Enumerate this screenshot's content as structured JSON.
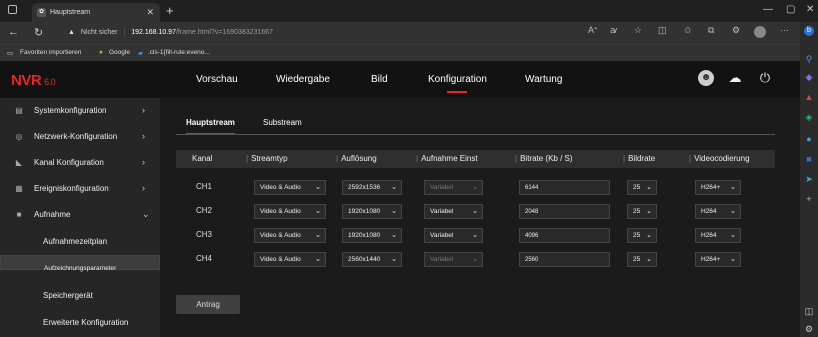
{
  "browser": {
    "tab_title": "Hauptstream",
    "url_security": "Nicht sicher",
    "url_host": "192.168.10.97",
    "url_path": "/frame.html?v=1690383231667",
    "bookmarks": [
      "Favoriten importieren",
      "Google",
      ".cls-1{fill-rule:eveno..."
    ]
  },
  "app": {
    "logo": "NVR",
    "version": "6.0",
    "nav": [
      "Vorschau",
      "Wiedergabe",
      "Bild",
      "Konfiguration",
      "Wartung"
    ],
    "active_nav": "Konfiguration"
  },
  "sidebar": {
    "items": [
      {
        "label": "Systemkonfiguration",
        "icon": "system-icon"
      },
      {
        "label": "Netzwerk-Konfiguration",
        "icon": "network-icon"
      },
      {
        "label": "Kanal Konfiguration",
        "icon": "camera-icon"
      },
      {
        "label": "Ereigniskonfiguration",
        "icon": "calendar-icon"
      },
      {
        "label": "Aufnahme",
        "icon": "record-icon"
      }
    ],
    "subitems": [
      "Aufnahmezeitplan",
      "Aufzeichnungsparameter",
      "Speichergerät",
      "Erweiterte Konfiguration"
    ],
    "selected_sub": "Aufzeichnungsparameter"
  },
  "main": {
    "tabs": [
      "Hauptstream",
      "Substream"
    ],
    "headers": [
      "Kanal",
      "Streamtyp",
      "Auflösung",
      "Aufnahme Einst",
      "Bitrate (Kb / S)",
      "Bildrate",
      "Videocodierung"
    ],
    "rows": [
      {
        "channel": "CH1",
        "stream": "Video & Audio",
        "resolution": "2592x1536",
        "record": "Variabel",
        "bitrate": "6144",
        "fps": "25",
        "codec": "H264+"
      },
      {
        "channel": "CH2",
        "stream": "Video & Audio",
        "resolution": "1920x1080",
        "record": "Variabel",
        "bitrate": "2048",
        "fps": "25",
        "codec": "H264"
      },
      {
        "channel": "CH3",
        "stream": "Video & Audio",
        "resolution": "1920x1080",
        "record": "Variabel",
        "bitrate": "4096",
        "fps": "25",
        "codec": "H264"
      },
      {
        "channel": "CH4",
        "stream": "Video & Audio",
        "resolution": "2560x1440",
        "record": "Variabel",
        "bitrate": "2560",
        "fps": "25",
        "codec": "H264+"
      }
    ],
    "apply": "Antrag"
  },
  "colors": {
    "accent": "#e8252a"
  }
}
